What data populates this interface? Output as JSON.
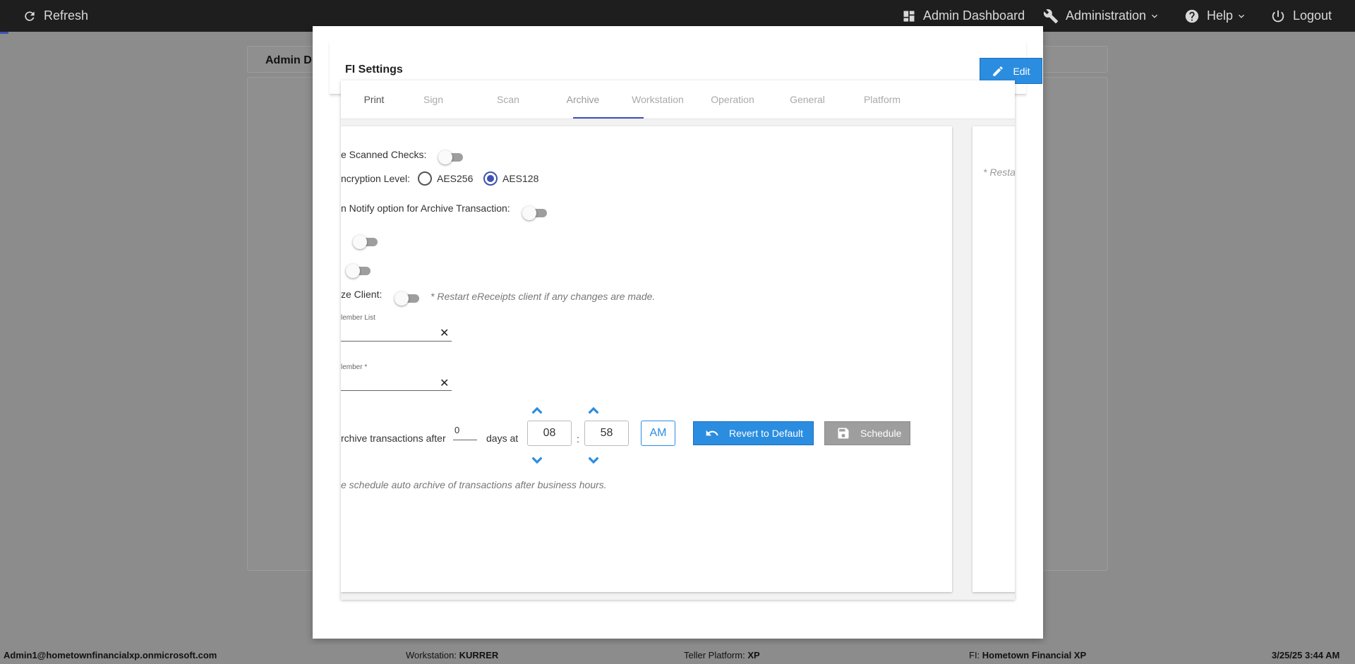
{
  "topbar": {
    "refresh_label": "Refresh",
    "admin_dashboard_label": "Admin Dashboard",
    "administration_label": "Administration",
    "help_label": "Help",
    "logout_label": "Logout"
  },
  "background": {
    "panel_header": "Admin D"
  },
  "modal": {
    "title": "FI Settings",
    "edit_label": "Edit",
    "tabs": [
      {
        "label": "Print"
      },
      {
        "label": "Sign"
      },
      {
        "label": "Scan"
      },
      {
        "label": "Archive"
      },
      {
        "label": "Workstation"
      },
      {
        "label": "Operation"
      },
      {
        "label": "General"
      },
      {
        "label": "Platform"
      }
    ],
    "active_tab": "Archive",
    "archive": {
      "scanned_checks_label": "e Scanned Checks:",
      "scanned_checks_on": false,
      "encryption_label": "ncryption Level:",
      "encryption_options": [
        "AES256",
        "AES128"
      ],
      "encryption_selected": "AES128",
      "notify_label": "n Notify option for Archive Transaction:",
      "notify_on": false,
      "toggle_a_on": false,
      "toggle_b_on": false,
      "client_label": "ze Client:",
      "client_on": false,
      "client_note": "* Restart eReceipts client if any changes are made.",
      "member_list_label": "lember List",
      "member_list_value": "",
      "member_label": "lember *",
      "member_value": "",
      "archive_after_label": "rchive transactions after",
      "days_value": "0",
      "days_at_label": "days at",
      "hour": "08",
      "time_sep": ":",
      "minute": "58",
      "ampm": "AM",
      "revert_label": "Revert to Default",
      "schedule_label": "Schedule",
      "schedule_note": "e schedule auto archive of transactions after business hours."
    },
    "right_note": "* Resta"
  },
  "statusbar": {
    "user": "Admin1@hometownfinancialxp.onmicrosoft.com",
    "workstation_label": "Workstation:",
    "workstation_value": "KURRER",
    "teller_label": "Teller Platform:",
    "teller_value": "XP",
    "fi_label": "FI:",
    "fi_value": "Hometown Financial XP",
    "datetime": "3/25/25 3:44 AM"
  },
  "colors": {
    "accent_blue": "#2b8de0",
    "indigo": "#3f51b5",
    "topbar_bg": "#1e1e1e",
    "overlay_bg": "#8c8c8c"
  }
}
